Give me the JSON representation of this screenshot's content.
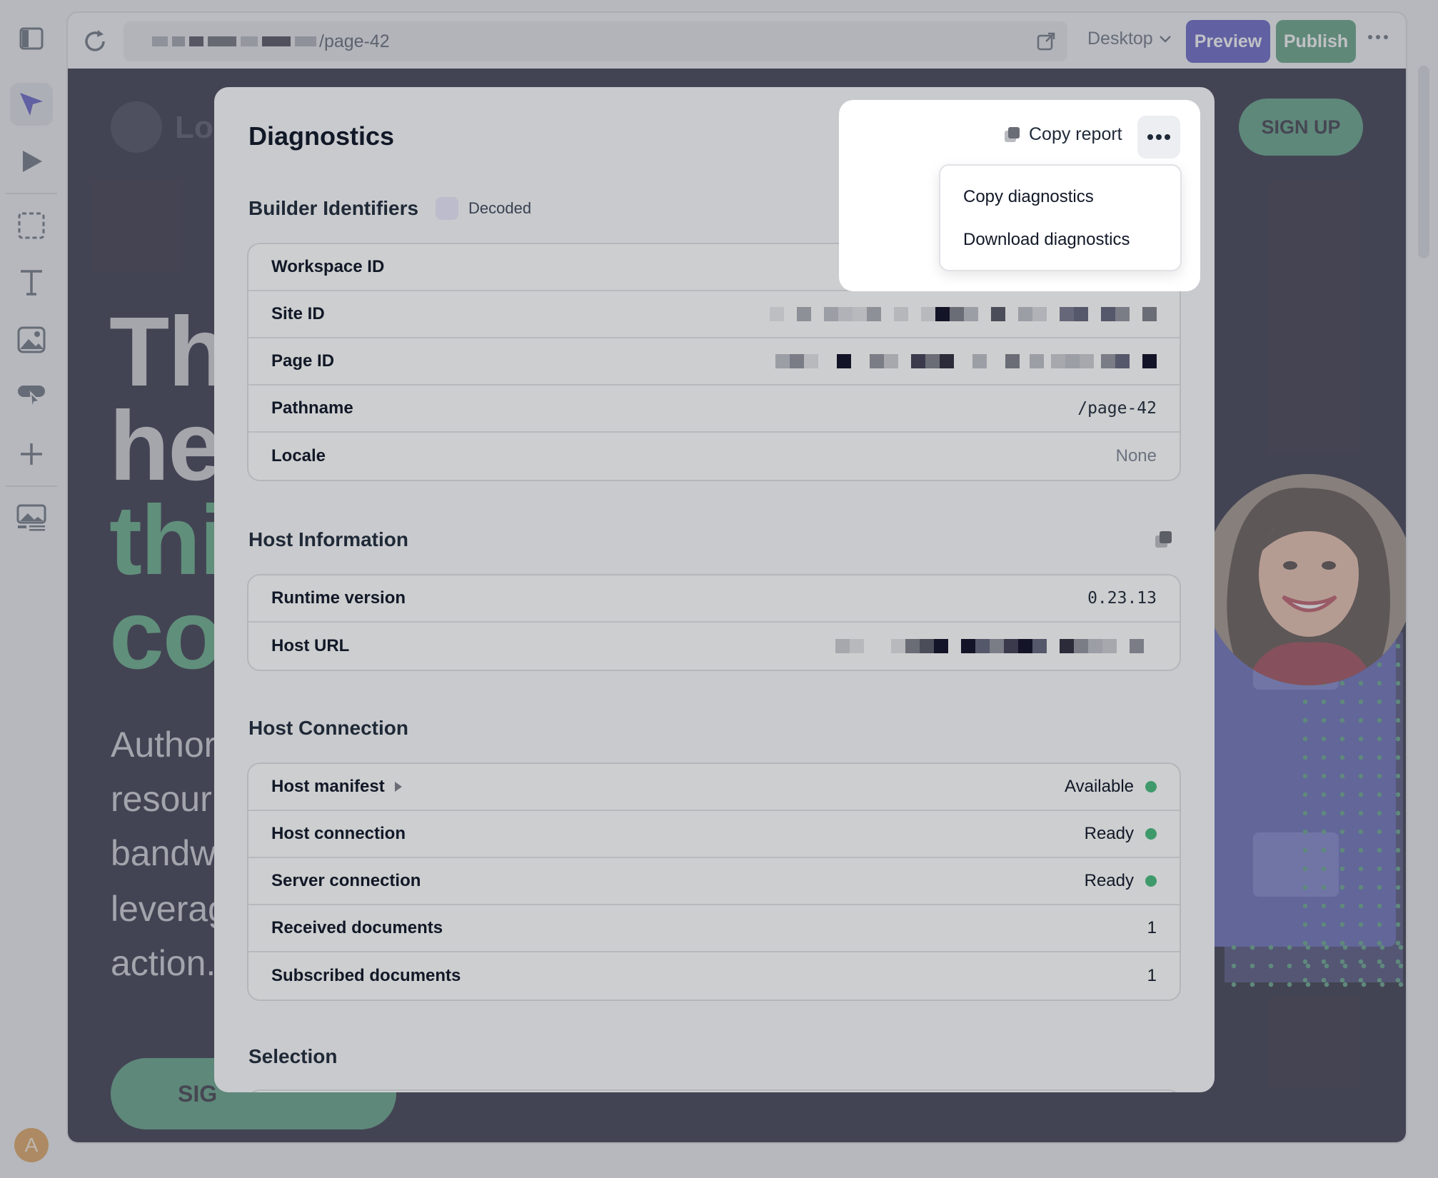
{
  "editor": {
    "url_path": "/page-42",
    "device_label": "Desktop",
    "preview_label": "Preview",
    "publish_label": "Publish",
    "user_initial": "A"
  },
  "site": {
    "logo_text": "Lo",
    "signup_label": "SIGN UP",
    "hero_lines": [
      "Th",
      "he",
      "thi",
      "co"
    ],
    "hero_paragraph_lines": [
      "Author",
      "resour",
      "bandw",
      "leverag",
      "action."
    ],
    "cta_label": "SIG"
  },
  "colors": {
    "accent_primary": "#3f3db8",
    "accent_publish": "#3f8c65",
    "status_ok": "#3f9a6b",
    "canvas_bg": "#05041a"
  },
  "diagnostics": {
    "title": "Diagnostics",
    "copy_report_label": "Copy report",
    "menu": {
      "items": [
        "Copy diagnostics",
        "Download diagnostics"
      ]
    },
    "builder_identifiers": {
      "title": "Builder Identifiers",
      "decoded_label": "Decoded",
      "rows": [
        {
          "label": "Workspace ID",
          "value": ""
        },
        {
          "label": "Site ID",
          "value": ""
        },
        {
          "label": "Page ID",
          "value": ""
        },
        {
          "label": "Pathname",
          "value": "/page-42"
        },
        {
          "label": "Locale",
          "value": "None"
        }
      ]
    },
    "host_information": {
      "title": "Host Information",
      "rows": [
        {
          "label": "Runtime version",
          "value": "0.23.13"
        },
        {
          "label": "Host URL",
          "value": ""
        }
      ]
    },
    "host_connection": {
      "title": "Host Connection",
      "rows": [
        {
          "label": "Host manifest",
          "value": "Available"
        },
        {
          "label": "Host connection",
          "value": "Ready"
        },
        {
          "label": "Server connection",
          "value": "Ready"
        },
        {
          "label": "Received documents",
          "value": "1"
        },
        {
          "label": "Subscribed documents",
          "value": "1"
        }
      ]
    },
    "selection": {
      "title": "Selection"
    }
  }
}
